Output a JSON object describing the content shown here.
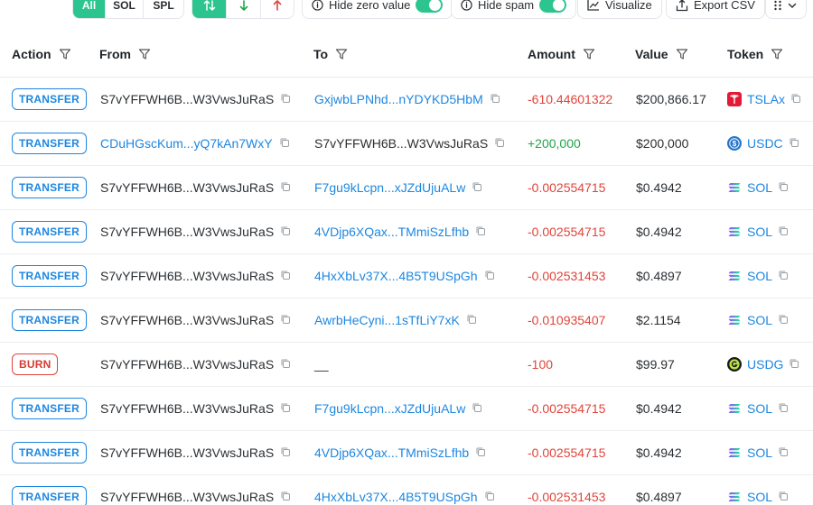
{
  "toolbar": {
    "filters": [
      "All",
      "SOL",
      "SPL"
    ],
    "active_filter": "All",
    "hide_zero_label": "Hide zero value",
    "hide_spam_label": "Hide spam",
    "visualize_label": "Visualize",
    "export_label": "Export CSV"
  },
  "table": {
    "headers": [
      "Action",
      "From",
      "To",
      "Amount",
      "Value",
      "Token"
    ],
    "rows": [
      {
        "action": "TRANSFER",
        "action_type": "transfer",
        "from": "S7vYFFWH6B...W3VwsJuRaS",
        "from_link": false,
        "to": "GxjwbLPNhd...nYDYKD5HbM",
        "to_link": true,
        "amount": "-610.44601322",
        "amount_sign": "neg",
        "value": "$200,866.17",
        "token": "TSLAx",
        "token_icon": "tesla-icon"
      },
      {
        "action": "TRANSFER",
        "action_type": "transfer",
        "from": "CDuHGscKum...yQ7kAn7WxY",
        "from_link": true,
        "to": "S7vYFFWH6B...W3VwsJuRaS",
        "to_link": false,
        "amount": "+200,000",
        "amount_sign": "pos",
        "value": "$200,000",
        "token": "USDC",
        "token_icon": "usdc-icon"
      },
      {
        "action": "TRANSFER",
        "action_type": "transfer",
        "from": "S7vYFFWH6B...W3VwsJuRaS",
        "from_link": false,
        "to": "F7gu9kLcpn...xJZdUjuALw",
        "to_link": true,
        "amount": "-0.002554715",
        "amount_sign": "neg",
        "value": "$0.4942",
        "token": "SOL",
        "token_icon": "sol-icon"
      },
      {
        "action": "TRANSFER",
        "action_type": "transfer",
        "from": "S7vYFFWH6B...W3VwsJuRaS",
        "from_link": false,
        "to": "4VDjp6XQax...TMmiSzLfhb",
        "to_link": true,
        "amount": "-0.002554715",
        "amount_sign": "neg",
        "value": "$0.4942",
        "token": "SOL",
        "token_icon": "sol-icon"
      },
      {
        "action": "TRANSFER",
        "action_type": "transfer",
        "from": "S7vYFFWH6B...W3VwsJuRaS",
        "from_link": false,
        "to": "4HxXbLv37X...4B5T9USpGh",
        "to_link": true,
        "amount": "-0.002531453",
        "amount_sign": "neg",
        "value": "$0.4897",
        "token": "SOL",
        "token_icon": "sol-icon"
      },
      {
        "action": "TRANSFER",
        "action_type": "transfer",
        "from": "S7vYFFWH6B...W3VwsJuRaS",
        "from_link": false,
        "to": "AwrbHeCyni...1sTfLiY7xK",
        "to_link": true,
        "amount": "-0.010935407",
        "amount_sign": "neg",
        "value": "$2.1154",
        "token": "SOL",
        "token_icon": "sol-icon"
      },
      {
        "action": "BURN",
        "action_type": "burn",
        "from": "S7vYFFWH6B...W3VwsJuRaS",
        "from_link": false,
        "to": "__",
        "to_link": false,
        "amount": "-100",
        "amount_sign": "neg",
        "value": "$99.97",
        "token": "USDG",
        "token_icon": "usdg-icon"
      },
      {
        "action": "TRANSFER",
        "action_type": "transfer",
        "from": "S7vYFFWH6B...W3VwsJuRaS",
        "from_link": false,
        "to": "F7gu9kLcpn...xJZdUjuALw",
        "to_link": true,
        "amount": "-0.002554715",
        "amount_sign": "neg",
        "value": "$0.4942",
        "token": "SOL",
        "token_icon": "sol-icon"
      },
      {
        "action": "TRANSFER",
        "action_type": "transfer",
        "from": "S7vYFFWH6B...W3VwsJuRaS",
        "from_link": false,
        "to": "4VDjp6XQax...TMmiSzLfhb",
        "to_link": true,
        "amount": "-0.002554715",
        "amount_sign": "neg",
        "value": "$0.4942",
        "token": "SOL",
        "token_icon": "sol-icon"
      },
      {
        "action": "TRANSFER",
        "action_type": "transfer",
        "from": "S7vYFFWH6B...W3VwsJuRaS",
        "from_link": false,
        "to": "4HxXbLv37X...4B5T9USpGh",
        "to_link": true,
        "amount": "-0.002531453",
        "amount_sign": "neg",
        "value": "$0.4897",
        "token": "SOL",
        "token_icon": "sol-icon"
      }
    ]
  },
  "colors": {
    "accent_green": "#2dc58f",
    "link_blue": "#1d87e0",
    "negative_red": "#e0443a",
    "positive_green": "#1fa64a"
  }
}
